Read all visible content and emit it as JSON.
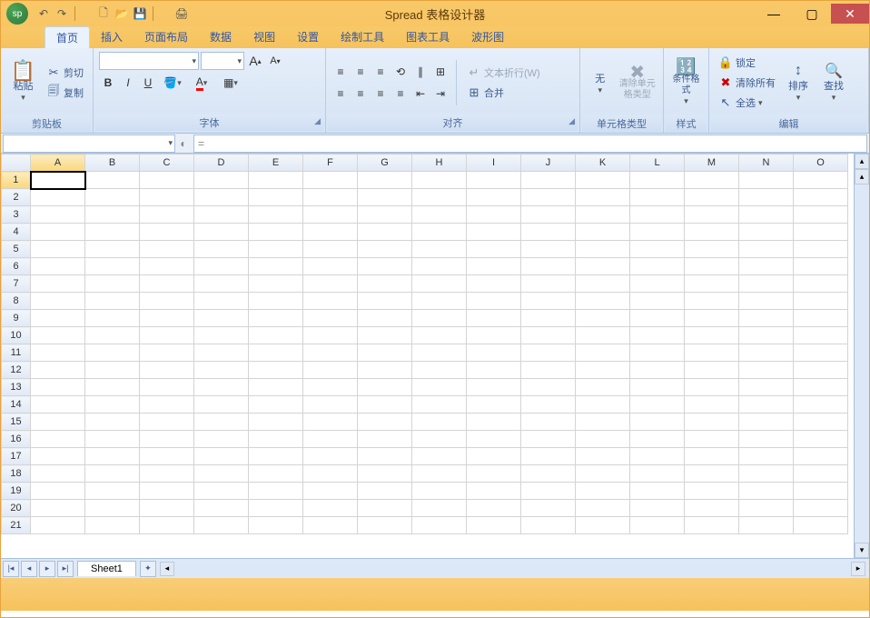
{
  "title": "Spread 表格设计器",
  "app_orb": "sp",
  "tabs": [
    "首页",
    "插入",
    "页面布局",
    "数据",
    "视图",
    "设置",
    "绘制工具",
    "图表工具",
    "波形图"
  ],
  "active_tab": 0,
  "groups": {
    "clipboard": {
      "label": "剪贴板",
      "paste": "粘贴",
      "cut": "剪切",
      "copy": "复制"
    },
    "font": {
      "label": "字体",
      "grow": "A",
      "shrink": "A",
      "bold": "B",
      "italic": "I",
      "underline": "U"
    },
    "align": {
      "label": "对齐",
      "wrap": "文本折行(W)",
      "merge": "合并"
    },
    "celltype": {
      "label": "单元格类型",
      "none": "无",
      "clear": "清除单元格类型"
    },
    "style": {
      "label": "样式",
      "cond": "条件格式"
    },
    "edit": {
      "label": "编辑",
      "sort": "排序",
      "find": "查找",
      "lock": "锁定",
      "clear": "清除所有",
      "selall": "全选"
    }
  },
  "namebox": "",
  "fx": "=",
  "columns": [
    "A",
    "B",
    "C",
    "D",
    "E",
    "F",
    "G",
    "H",
    "I",
    "J",
    "K",
    "L",
    "M",
    "N",
    "O"
  ],
  "rows": [
    1,
    2,
    3,
    4,
    5,
    6,
    7,
    8,
    9,
    10,
    11,
    12,
    13,
    14,
    15,
    16,
    17,
    18,
    19,
    20,
    21
  ],
  "active_cell": {
    "row": 0,
    "col": 0
  },
  "sheet_tab": "Sheet1"
}
